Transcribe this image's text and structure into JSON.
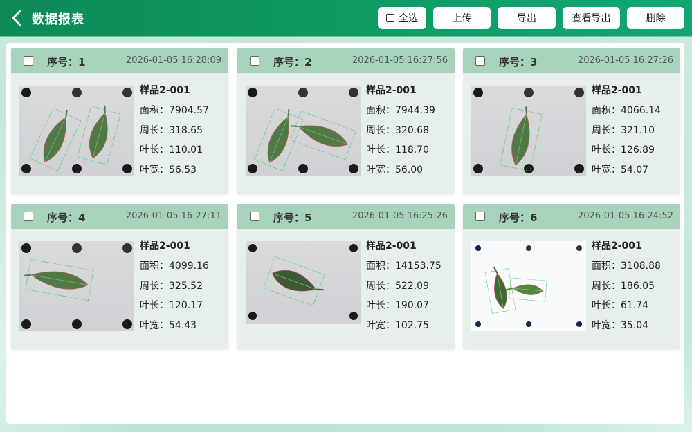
{
  "header": {
    "title": "数据报表",
    "buttons": {
      "select_all": "全选",
      "upload": "上传",
      "export": "导出",
      "view_export": "查看导出",
      "delete": "删除"
    }
  },
  "labels": {
    "no_prefix": "序号：",
    "area": "面积：",
    "perimeter": "周长：",
    "leaf_length": "叶长：",
    "leaf_width": "叶宽："
  },
  "cards": [
    {
      "no": "序号：1",
      "time": "2026-01-05 16:28:09",
      "name": "样品2-001",
      "area": "7904.57",
      "perimeter": "318.65",
      "length": "110.01",
      "width": "56.53"
    },
    {
      "no": "序号：2",
      "time": "2026-01-05 16:27:56",
      "name": "样品2-001",
      "area": "7944.39",
      "perimeter": "320.68",
      "length": "118.70",
      "width": "56.00"
    },
    {
      "no": "序号：3",
      "time": "2026-01-05 16:27:26",
      "name": "样品2-001",
      "area": "4066.14",
      "perimeter": "321.10",
      "length": "126.89",
      "width": "54.07"
    },
    {
      "no": "序号：4",
      "time": "2026-01-05 16:27:11",
      "name": "样品2-001",
      "area": "4099.16",
      "perimeter": "325.52",
      "length": "120.17",
      "width": "54.43"
    },
    {
      "no": "序号：5",
      "time": "2026-01-05 16:25:26",
      "name": "样品2-001",
      "area": "14153.75",
      "perimeter": "522.09",
      "length": "190.07",
      "width": "102.75"
    },
    {
      "no": "序号：6",
      "time": "2026-01-05 16:24:52",
      "name": "样品2-001",
      "area": "3108.88",
      "perimeter": "186.05",
      "length": "61.74",
      "width": "35.04"
    }
  ],
  "colors": {
    "header": "#0e9a63",
    "card_head": "#a7d3bd",
    "card_body": "#e7efec",
    "leaf": "#4f7a45"
  }
}
